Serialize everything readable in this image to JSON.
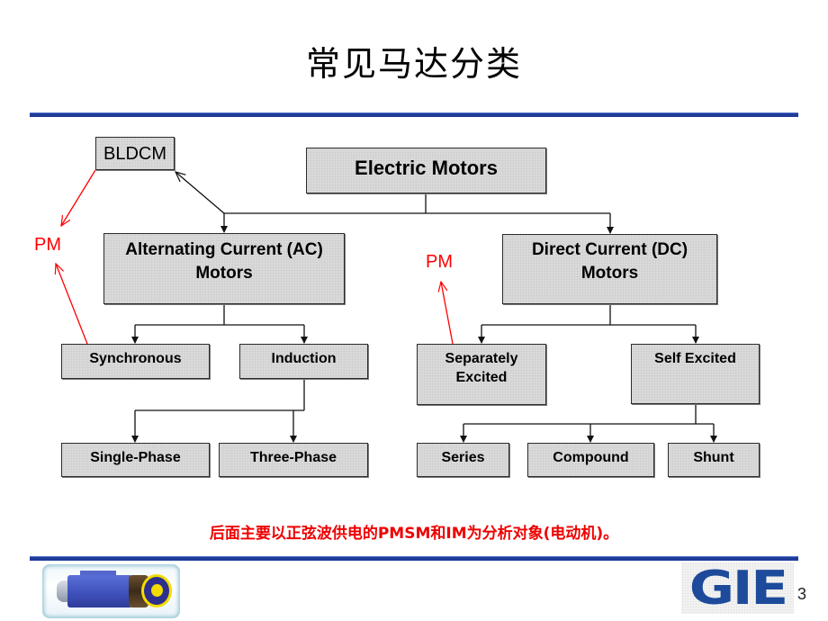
{
  "slide": {
    "title": "常见马达分类",
    "footer_note": "后面主要以正弦波供电的PMSM和IM为分析对象(电动机)。",
    "page_number": "3"
  },
  "diagram": {
    "root": "Electric Motors",
    "ac": {
      "line1": "Alternating Current (AC)",
      "line2": "Motors"
    },
    "dc": {
      "line1": "Direct Current (DC)",
      "line2": "Motors"
    },
    "ac_children": {
      "synchronous": "Synchronous",
      "induction": "Induction"
    },
    "induction_children": {
      "single_phase": "Single-Phase",
      "three_phase": "Three-Phase"
    },
    "dc_children": {
      "separately_excited": {
        "line1": "Separately",
        "line2": "Excited"
      },
      "self_excited": "Self Excited"
    },
    "self_excited_children": {
      "series": "Series",
      "compound": "Compound",
      "shunt": "Shunt"
    },
    "annotations": {
      "bldcm": "BLDCM",
      "pm_left": "PM",
      "pm_right": "PM"
    }
  },
  "logo": {
    "text": "GIE"
  },
  "colors": {
    "rule_blue": "#1f3c9a",
    "annotation_red": "#ff0000",
    "box_fill": "#d8d8d8",
    "logo_blue": "#1d4a9a"
  }
}
